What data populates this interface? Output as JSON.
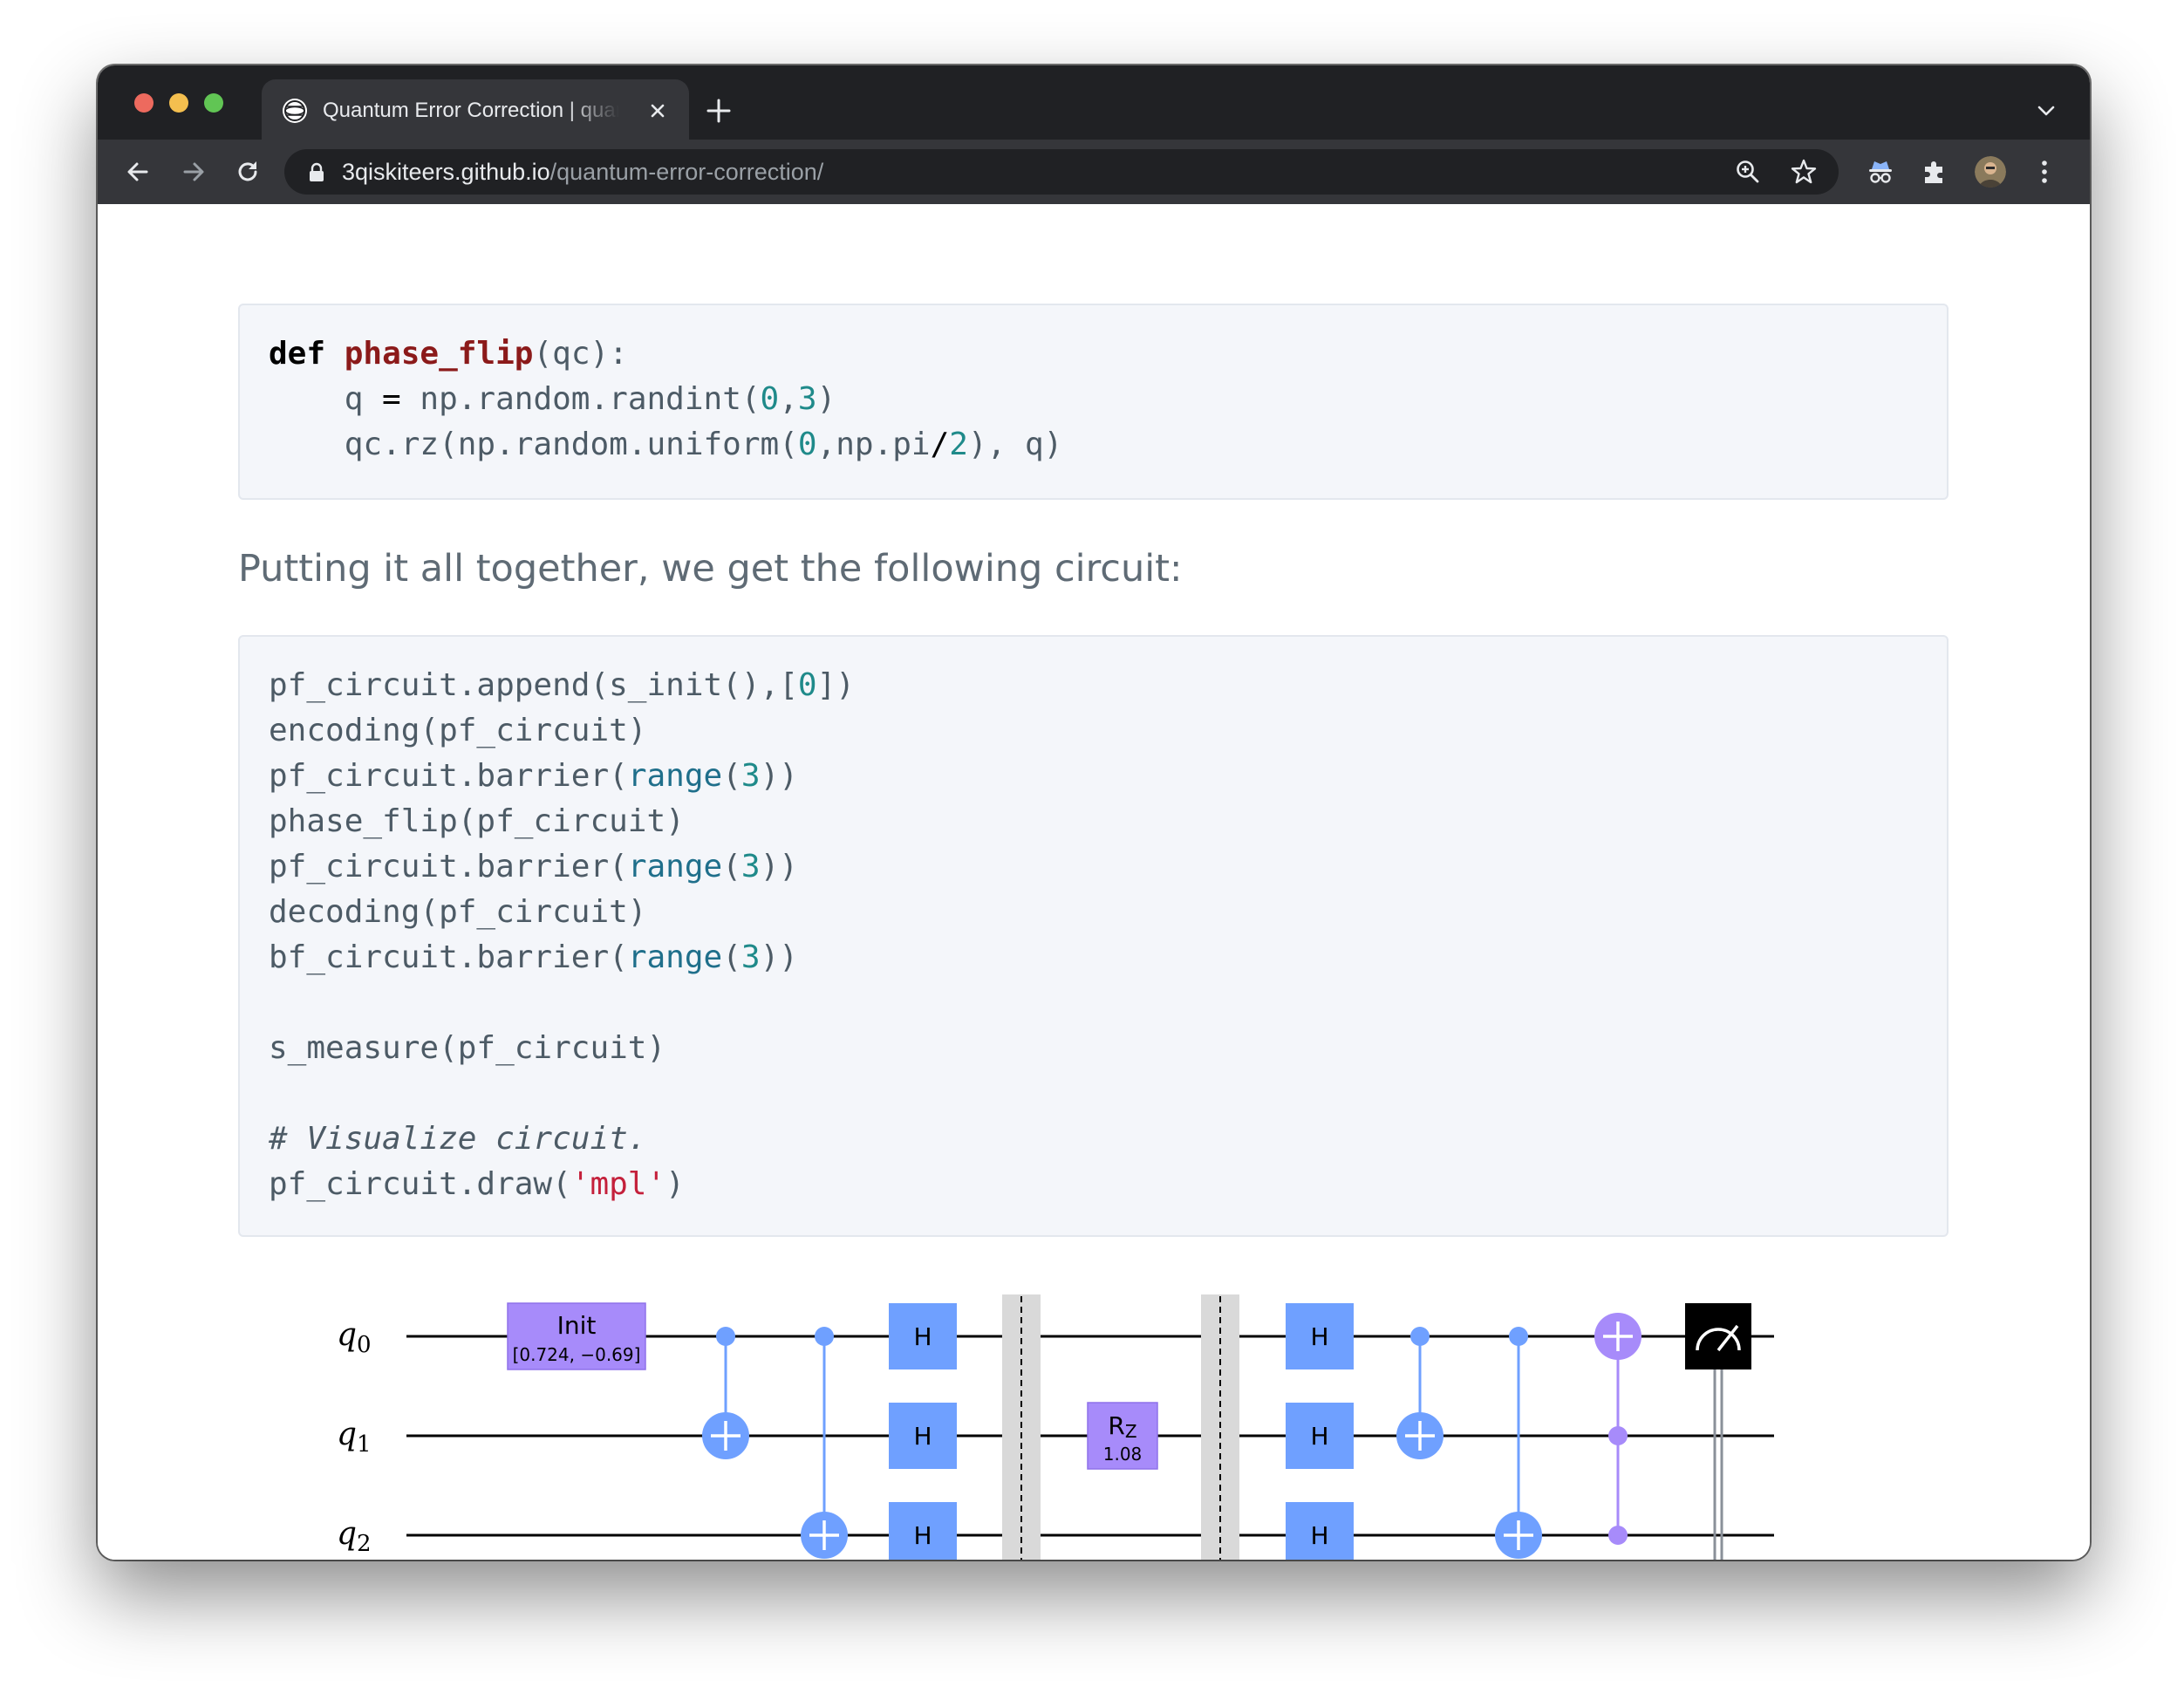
{
  "browser": {
    "tab_title": "Quantum Error Correction | quantum-error-correction",
    "url_host": "3qiskiteers.github.io",
    "url_path": "/quantum-error-correction/"
  },
  "code_block_1": {
    "lines": [
      [
        "def",
        " ",
        "phase_flip",
        "(qc):"
      ],
      [
        "    q ",
        "=",
        " np.random.randint(",
        "0",
        ",",
        "3",
        ")"
      ],
      [
        "    qc.rz(np.random.uniform(",
        "0",
        ",np.pi",
        "/",
        "2",
        "), q)"
      ]
    ]
  },
  "paragraph": "Putting it all together, we get the following circuit:",
  "code_block_2": {
    "l1a": "pf_circuit.append(s_init(),[",
    "l1b": "0",
    "l1c": "])",
    "l2": "encoding(pf_circuit)",
    "l3a": "pf_circuit.barrier(",
    "l3b": "range",
    "l3c": "(",
    "l3d": "3",
    "l3e": "))",
    "l4": "phase_flip(pf_circuit)",
    "l5a": "pf_circuit.barrier(",
    "l5b": "range",
    "l5c": "(",
    "l5d": "3",
    "l5e": "))",
    "l6": "decoding(pf_circuit)",
    "l7a": "bf_circuit.barrier(",
    "l7b": "range",
    "l7c": "(",
    "l7d": "3",
    "l7e": "))",
    "l8": "s_measure(pf_circuit)",
    "l9": "# Visualize circuit.",
    "l10a": "pf_circuit.draw(",
    "l10b": "'mpl'",
    "l10c": ")"
  },
  "circuit": {
    "qubits": [
      "q",
      "q",
      "q"
    ],
    "qubit_subscripts": [
      "0",
      "1",
      "2"
    ],
    "init_label": "Init",
    "init_params": "[0.724, −0.69]",
    "h_label": "H",
    "rz_label": "R",
    "rz_sub": "Z",
    "rz_param": "1.08",
    "colors": {
      "init": "#a78bfa",
      "h": "#6fa0ff",
      "cnot": "#6fa0ff",
      "toffoli": "#a78bfa",
      "barrier": "#d9d9d9",
      "measure": "#000000"
    }
  }
}
